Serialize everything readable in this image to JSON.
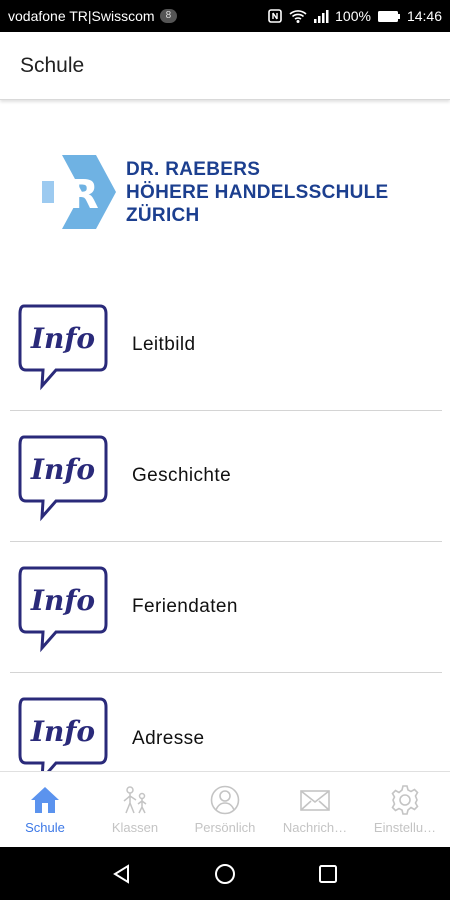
{
  "status_bar": {
    "carrier": "vodafone TR|Swisscom",
    "notification_count": "8",
    "battery": "100%",
    "time": "14:46"
  },
  "app_bar": {
    "title": "Schule"
  },
  "logo": {
    "line1": "DR. RAEBERS",
    "line2": "HÖHERE HANDELSSCHULE",
    "line3": "ZÜRICH",
    "letter": "R",
    "color": "#1c3f8f"
  },
  "items": [
    {
      "label": "Leitbild",
      "icon_text": "Info"
    },
    {
      "label": "Geschichte",
      "icon_text": "Info"
    },
    {
      "label": "Feriendaten",
      "icon_text": "Info"
    },
    {
      "label": "Adresse",
      "icon_text": "Info"
    }
  ],
  "tabs": [
    {
      "label": "Schule",
      "icon": "home-icon",
      "active": true
    },
    {
      "label": "Klassen",
      "icon": "students-icon",
      "active": false
    },
    {
      "label": "Persönlich",
      "icon": "person-icon",
      "active": false
    },
    {
      "label": "Nachrich…",
      "icon": "mail-icon",
      "active": false
    },
    {
      "label": "Einstellu…",
      "icon": "gear-icon",
      "active": false
    }
  ],
  "colors": {
    "accent": "#3c78e6",
    "inactive_tab": "#c4c4c4",
    "info_icon": "#2a2a7a"
  }
}
